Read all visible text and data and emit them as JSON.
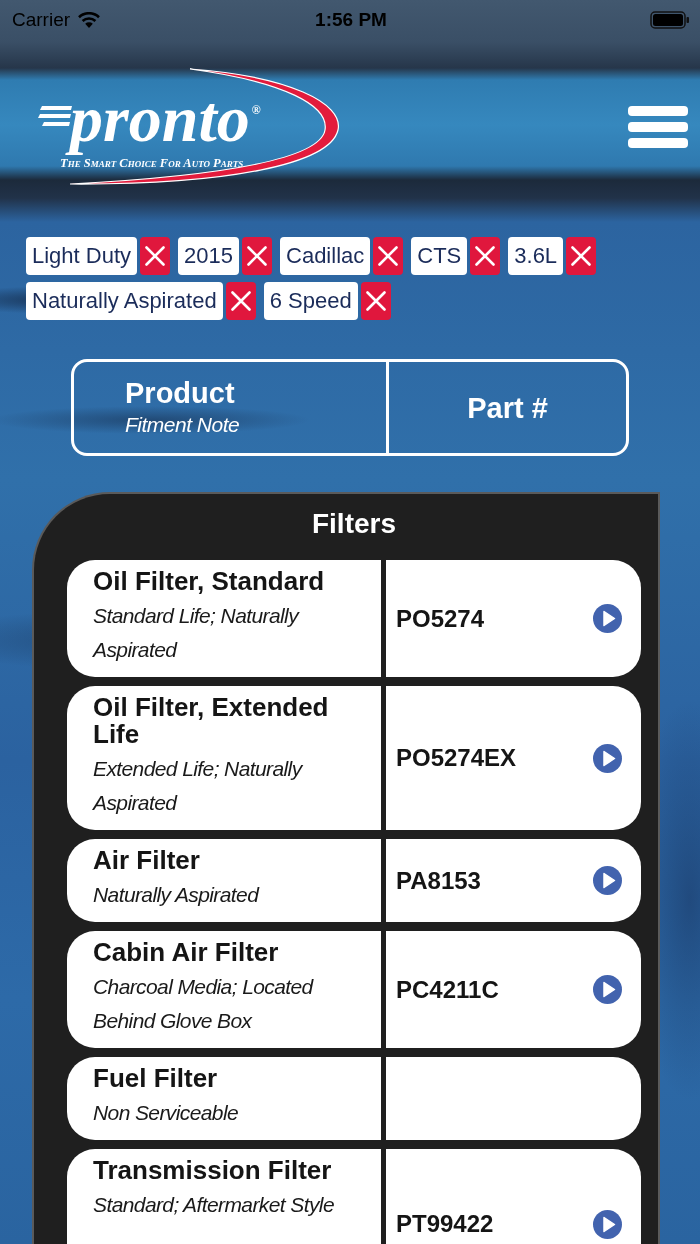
{
  "status_bar": {
    "carrier": "Carrier",
    "time": "1:56 PM"
  },
  "logo": {
    "wordmark": "pronto$^{®}$",
    "tagline": "The Smart Choice For Auto Parts"
  },
  "filter_chips": [
    "Light Duty",
    "2015",
    "Cadillac",
    "CTS",
    "3.6L",
    "Naturally Aspirated",
    "6 Speed"
  ],
  "table_header": {
    "product": "Product",
    "fitment_note": "Fitment Note",
    "part_number": "Part #"
  },
  "section": {
    "title": "Filters",
    "rows": [
      {
        "product": "Oil Filter, Standard",
        "note": "Standard Life; Naturally Aspirated",
        "part_number": "PO5274"
      },
      {
        "product": "Oil Filter, Extended Life",
        "note": "Extended Life; Naturally Aspirated",
        "part_number": "PO5274EX"
      },
      {
        "product": "Air Filter",
        "note": "Naturally Aspirated",
        "part_number": "PA8153"
      },
      {
        "product": "Cabin Air Filter",
        "note": "Charcoal Media; Located Behind Glove Box",
        "part_number": "PC4211C"
      },
      {
        "product": "Fuel Filter",
        "note": "Non Serviceable"
      },
      {
        "product": "Transmission Filter",
        "note": "Standard; Aftermarket Style",
        "part_number": "PT99422"
      }
    ]
  }
}
